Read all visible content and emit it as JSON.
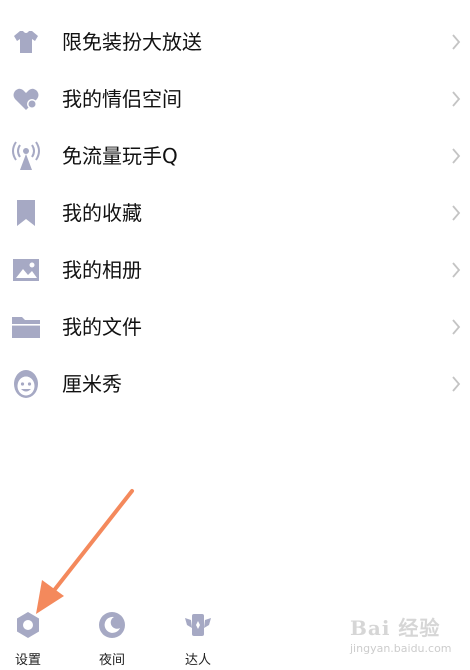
{
  "menu": {
    "items": [
      {
        "label": "限免装扮大放送",
        "icon": "tshirt-icon"
      },
      {
        "label": "我的情侣空间",
        "icon": "heart-icon"
      },
      {
        "label": "免流量玩手Q",
        "icon": "antenna-icon"
      },
      {
        "label": "我的收藏",
        "icon": "bookmark-icon"
      },
      {
        "label": "我的相册",
        "icon": "photo-icon"
      },
      {
        "label": "我的文件",
        "icon": "folder-icon"
      },
      {
        "label": "厘米秀",
        "icon": "face-icon"
      }
    ]
  },
  "bottom_bar": {
    "settings_label": "设置",
    "night_label": "夜间",
    "talent_label": "达人"
  },
  "watermark": {
    "text": "Bai 经验",
    "url": "jingyan.baidu.com"
  },
  "colors": {
    "icon": "#a6a9c4",
    "chevron": "#c4c4c4",
    "arrow": "#f4895c"
  }
}
